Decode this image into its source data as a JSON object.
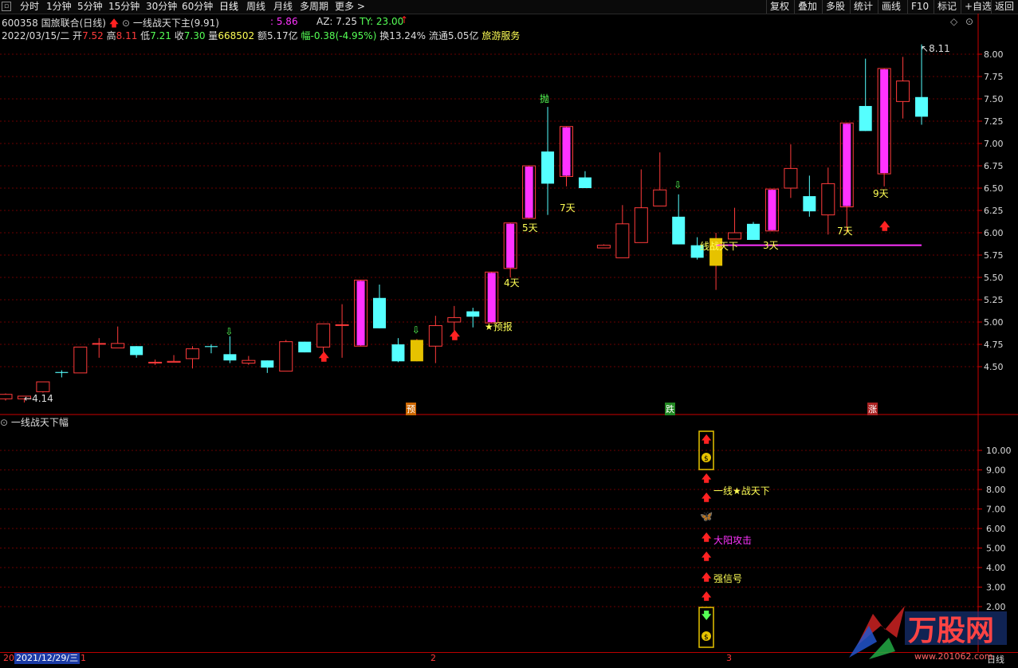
{
  "toolbar": {
    "periods": [
      "分时",
      "1分钟",
      "5分钟",
      "15分钟",
      "30分钟",
      "60分钟",
      "日线",
      "周线",
      "月线",
      "多周期",
      "更多"
    ],
    "active": "日线",
    "right_buttons": [
      "复权",
      "叠加",
      "多股",
      "统计",
      "画线",
      "F10",
      "标记",
      "+自选",
      "返回"
    ]
  },
  "stock": {
    "code_name": "600358 国旅联合(日线)",
    "indicator_name": "一线战天下主(9.91)",
    "indicator_value": ": 5.86",
    "az": "AZ: 7.25",
    "ty": "TY: 23.00",
    "date": "2022/03/15/二",
    "open_label": "开",
    "open": "7.52",
    "high_label": "高",
    "high": "8.11",
    "low_label": "低",
    "low": "7.21",
    "close_label": "收",
    "close": "7.30",
    "vol_label": "量",
    "vol": "668502",
    "amt": "额5.17亿",
    "chg": "幅-0.38(-4.95%)",
    "turnover": "换13.24%",
    "float": "流通5.05亿",
    "sector": "旅游服务"
  },
  "colors": {
    "up": "#ff3b3b",
    "down": "#55ffff",
    "magenta": "#ff33ff",
    "yellow": "#ffff55",
    "gold": "#e6c200",
    "axis": "#cc0000"
  },
  "price_axis": [
    "8.00",
    "7.75",
    "7.50",
    "7.25",
    "7.00",
    "6.75",
    "6.50",
    "6.25",
    "6.00",
    "5.75",
    "5.50",
    "5.25",
    "5.00",
    "4.75",
    "4.50"
  ],
  "ind_axis": [
    "10.00",
    "9.00",
    "8.00",
    "7.00",
    "6.00",
    "5.00",
    "4.00",
    "3.00",
    "2.00"
  ],
  "annotations": {
    "max": "8.11",
    "min": "4.14",
    "pao": "抛",
    "d5": "5天",
    "d7a": "7天",
    "d4": "4天",
    "d3": "3天",
    "d7b": "7天",
    "d9": "9天",
    "yubao": "预报",
    "xzt": "线战天下",
    "tag_yu": "预",
    "tag_die": "跌",
    "tag_zhang": "涨"
  },
  "indicator": {
    "title": "一线战天下幅",
    "label1": "一线★战天下",
    "label2": "大阳攻击",
    "label3": "强信号"
  },
  "bottom": {
    "date_box": "2021/12/29/三",
    "prefix": "20",
    "ticks": [
      "1",
      "2",
      "3"
    ],
    "period": "日线",
    "website": "www.201062.com"
  },
  "watermark": "万股网",
  "chart_data": {
    "type": "candlestick",
    "series": [
      {
        "o": 4.14,
        "h": 4.2,
        "l": 4.12,
        "c": 4.19
      },
      {
        "o": 4.14,
        "h": 4.17,
        "l": 4.1,
        "c": 4.17
      },
      {
        "o": 4.22,
        "h": 4.33,
        "l": 4.21,
        "c": 4.33
      },
      {
        "o": 4.44,
        "h": 4.46,
        "l": 4.38,
        "c": 4.43
      },
      {
        "o": 4.43,
        "h": 4.72,
        "l": 4.43,
        "c": 4.72
      },
      {
        "o": 4.76,
        "h": 4.82,
        "l": 4.6,
        "c": 4.76
      },
      {
        "o": 4.71,
        "h": 4.95,
        "l": 4.71,
        "c": 4.76
      },
      {
        "o": 4.73,
        "h": 4.73,
        "l": 4.6,
        "c": 4.63
      },
      {
        "o": 4.55,
        "h": 4.58,
        "l": 4.52,
        "c": 4.55
      },
      {
        "o": 4.55,
        "h": 4.63,
        "l": 4.55,
        "c": 4.56
      },
      {
        "o": 4.59,
        "h": 4.73,
        "l": 4.48,
        "c": 4.7
      },
      {
        "o": 4.73,
        "h": 4.75,
        "l": 4.65,
        "c": 4.72
      },
      {
        "o": 4.64,
        "h": 4.84,
        "l": 4.54,
        "c": 4.57
      },
      {
        "o": 4.54,
        "h": 4.62,
        "l": 4.52,
        "c": 4.57
      },
      {
        "o": 4.57,
        "h": 4.57,
        "l": 4.43,
        "c": 4.49
      },
      {
        "o": 4.45,
        "h": 4.8,
        "l": 4.45,
        "c": 4.78
      },
      {
        "o": 4.78,
        "h": 4.78,
        "l": 4.66,
        "c": 4.66
      },
      {
        "o": 4.72,
        "h": 4.98,
        "l": 4.66,
        "c": 4.98
      },
      {
        "o": 4.97,
        "h": 5.2,
        "l": 4.6,
        "c": 4.97
      },
      {
        "o": 4.73,
        "h": 5.47,
        "l": 4.73,
        "c": 5.47
      },
      {
        "o": 5.27,
        "h": 5.42,
        "l": 4.93,
        "c": 4.93
      },
      {
        "o": 4.75,
        "h": 4.82,
        "l": 4.55,
        "c": 4.56
      },
      {
        "o": 4.56,
        "h": 4.81,
        "l": 4.56,
        "c": 4.8
      },
      {
        "o": 4.73,
        "h": 5.07,
        "l": 4.54,
        "c": 4.96
      },
      {
        "o": 5.0,
        "h": 5.18,
        "l": 4.9,
        "c": 5.05
      },
      {
        "o": 5.12,
        "h": 5.16,
        "l": 4.94,
        "c": 5.06
      },
      {
        "o": 4.99,
        "h": 5.56,
        "l": 4.99,
        "c": 5.56
      },
      {
        "o": 5.6,
        "h": 6.11,
        "l": 5.5,
        "c": 6.11
      },
      {
        "o": 6.16,
        "h": 6.75,
        "l": 6.16,
        "c": 6.75
      },
      {
        "o": 6.91,
        "h": 7.41,
        "l": 6.2,
        "c": 6.55
      },
      {
        "o": 6.63,
        "h": 7.19,
        "l": 6.52,
        "c": 7.19
      },
      {
        "o": 6.62,
        "h": 6.69,
        "l": 6.5,
        "c": 6.5
      },
      {
        "o": 5.83,
        "h": 5.87,
        "l": 5.83,
        "c": 5.86
      },
      {
        "o": 5.72,
        "h": 6.31,
        "l": 5.72,
        "c": 6.1
      },
      {
        "o": 5.89,
        "h": 6.71,
        "l": 5.89,
        "c": 6.28
      },
      {
        "o": 6.3,
        "h": 6.9,
        "l": 6.3,
        "c": 6.48
      },
      {
        "o": 6.18,
        "h": 6.43,
        "l": 5.87,
        "c": 5.87
      },
      {
        "o": 5.86,
        "h": 5.95,
        "l": 5.7,
        "c": 5.72
      },
      {
        "o": 5.63,
        "h": 6.0,
        "l": 5.36,
        "c": 5.94
      },
      {
        "o": 5.93,
        "h": 6.28,
        "l": 5.93,
        "c": 6.0
      },
      {
        "o": 6.1,
        "h": 6.12,
        "l": 5.92,
        "c": 5.92
      },
      {
        "o": 6.02,
        "h": 6.49,
        "l": 6.02,
        "c": 6.49
      },
      {
        "o": 6.5,
        "h": 6.99,
        "l": 6.39,
        "c": 6.72
      },
      {
        "o": 6.41,
        "h": 6.64,
        "l": 6.18,
        "c": 6.24
      },
      {
        "o": 6.2,
        "h": 6.73,
        "l": 5.98,
        "c": 6.55
      },
      {
        "o": 6.29,
        "h": 7.23,
        "l": 6.0,
        "c": 7.23
      },
      {
        "o": 7.42,
        "h": 7.95,
        "l": 7.14,
        "c": 7.14
      },
      {
        "o": 6.66,
        "h": 7.84,
        "l": 6.52,
        "c": 7.84
      },
      {
        "o": 7.47,
        "h": 7.97,
        "l": 7.28,
        "c": 7.7
      },
      {
        "o": 7.52,
        "h": 8.11,
        "l": 7.21,
        "c": 7.3
      }
    ],
    "special": {
      "32": "magenta",
      "38": "gold",
      "22": "gold"
    },
    "ylim": [
      4.1,
      8.15
    ],
    "hline": {
      "y": 5.86,
      "from": 38,
      "to": 49,
      "color": "#ff33ff"
    }
  }
}
